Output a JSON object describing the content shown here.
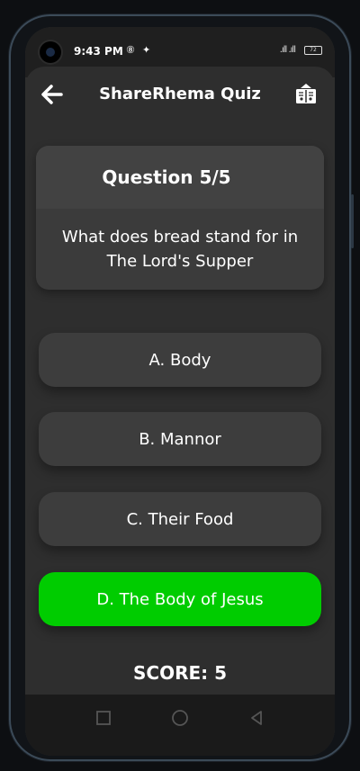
{
  "status_bar": {
    "time": "9:43 PM",
    "icons": [
      "notification-icon",
      "app-icon",
      "signal-icon",
      "battery-icon"
    ],
    "battery": "72"
  },
  "app_bar": {
    "title": "ShareRhema Quiz",
    "back_icon": "arrow-left-icon",
    "logo_icon": "book-logo-icon"
  },
  "question": {
    "header": "Question 5/5",
    "text": "What does bread stand for in The Lord's Supper"
  },
  "answers": [
    {
      "label": "A. Body",
      "state": "default"
    },
    {
      "label": "B. Mannor",
      "state": "default"
    },
    {
      "label": "C. Their Food",
      "state": "default"
    },
    {
      "label": "D. The Body of Jesus",
      "state": "correct"
    }
  ],
  "score": "SCORE: 5",
  "colors": {
    "background": "#2e2e2e",
    "card": "#3b3b3b",
    "correct": "#00cc00",
    "text": "#ffffff"
  },
  "nav_icons": [
    "recent-apps-icon",
    "home-icon",
    "back-nav-icon"
  ]
}
